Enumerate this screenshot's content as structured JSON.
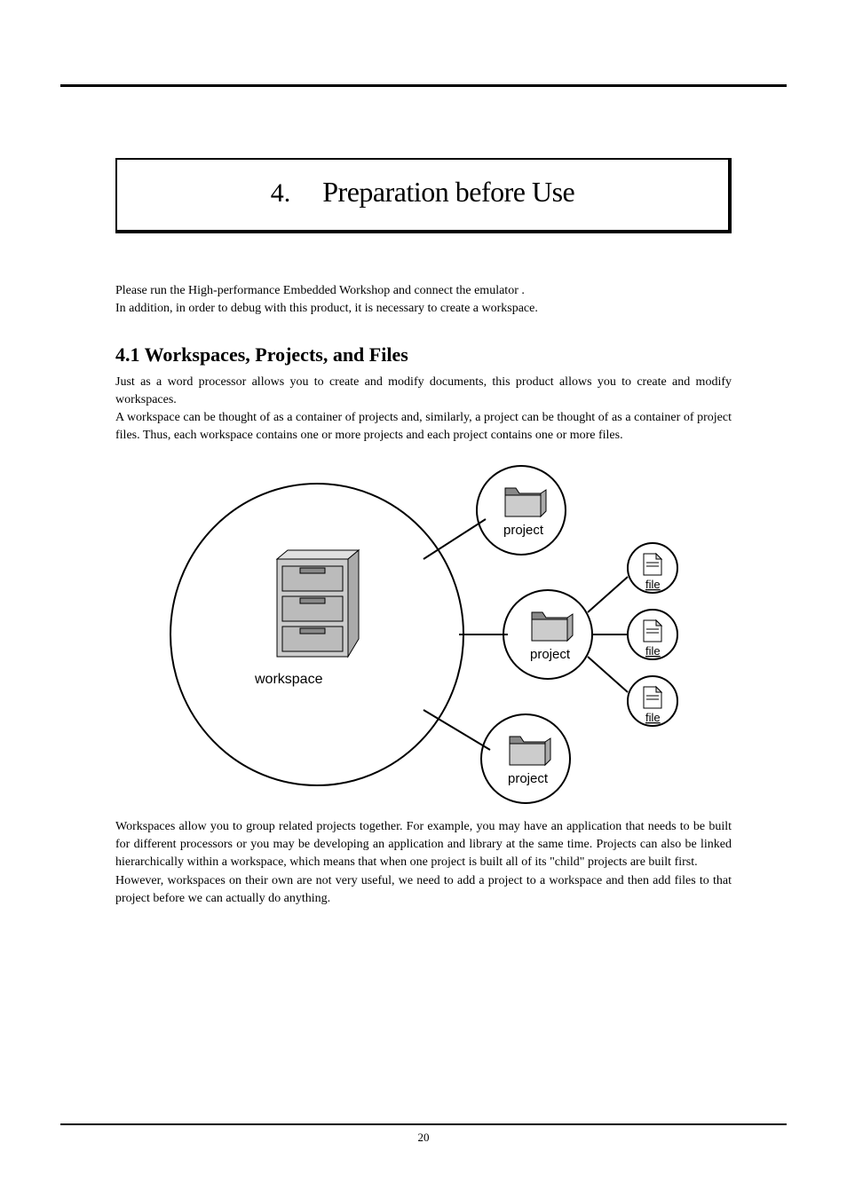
{
  "chapter": {
    "number": "4.",
    "title": "Preparation before Use"
  },
  "intro": {
    "line1": "Please run the High-performance Embedded Workshop and connect the emulator .",
    "line2": "In addition, in order to debug with this product, it is necessary to create a workspace."
  },
  "section": {
    "heading": "4.1 Workspaces, Projects, and Files",
    "para1": "Just as a word processor allows you to create and modify documents, this product allows you to create and modify workspaces.",
    "para2": "A workspace can be thought of as a container of projects and, similarly, a project can be thought of as a container of project files. Thus, each workspace contains one or more projects and each project contains one or more files.",
    "para3": "Workspaces allow you to group related projects together. For example, you may have an application that needs to be built for different processors or you may be developing an application and library at the same time. Projects can also be linked hierarchically within a workspace, which means that when one project is built all of its \"child\" projects are built first.",
    "para4": "However, workspaces on their own are not very useful, we need to add a project to a workspace and then add files to that project before we can actually do anything."
  },
  "diagram": {
    "workspace_label": "workspace",
    "project_label_1": "project",
    "project_label_2": "project",
    "project_label_3": "project",
    "file_label_1": "file",
    "file_label_2": "file",
    "file_label_3": "file"
  },
  "page_number": "20"
}
